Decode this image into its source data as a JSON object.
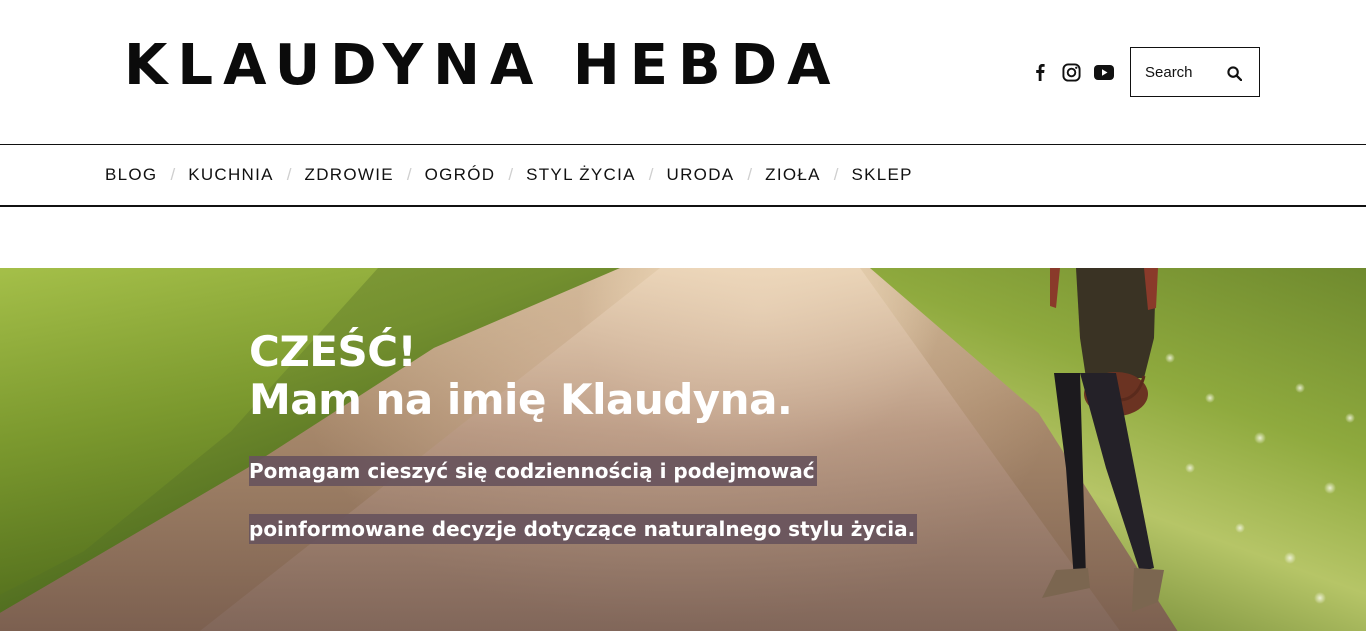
{
  "site": {
    "logo": "KLAUDYNA HEBDA"
  },
  "header": {
    "social": [
      {
        "icon": "facebook-icon"
      },
      {
        "icon": "instagram-icon"
      },
      {
        "icon": "youtube-icon"
      }
    ],
    "search": {
      "placeholder": "Search",
      "icon": "search-icon"
    }
  },
  "nav": {
    "items": [
      "BLOG",
      "KUCHNIA",
      "ZDROWIE",
      "OGRÓD",
      "STYL ŻYCIA",
      "URODA",
      "ZIOŁA",
      "SKLEP"
    ],
    "separator": "/"
  },
  "hero": {
    "heading_line1": "CZEŚĆ!",
    "heading_line2": "Mam na imię Klaudyna.",
    "subtitle_line1": "Pomagam cieszyć się codziennością i podejmować ",
    "subtitle_line2": "poinformowane decyzje dotyczące naturalnego stylu życia.",
    "highlight_color": "#68545c"
  }
}
